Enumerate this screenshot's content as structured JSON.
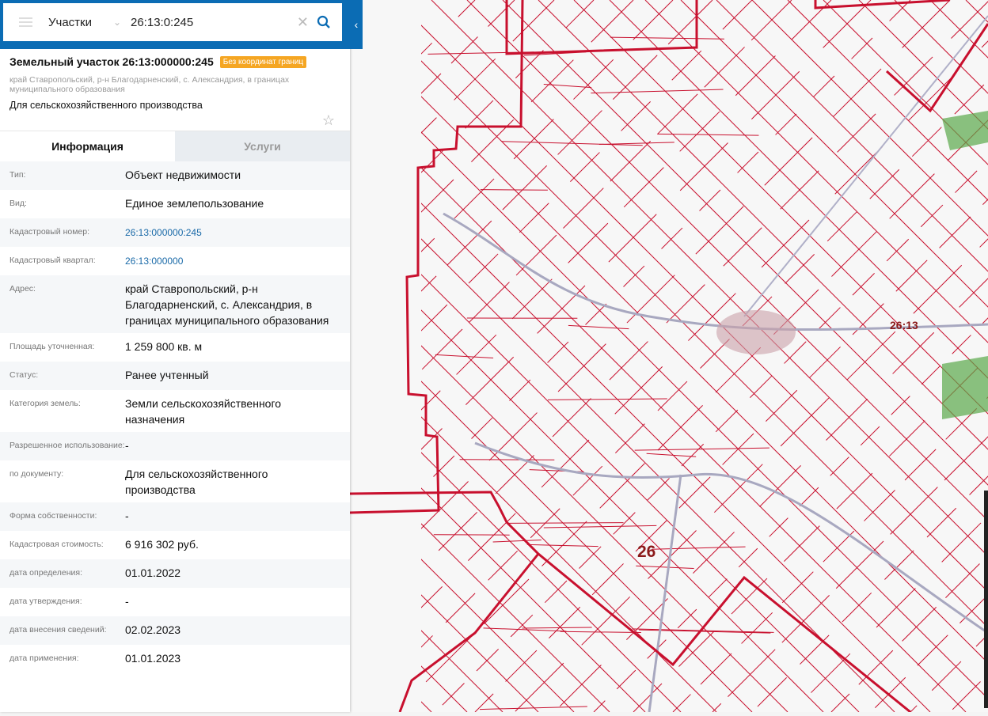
{
  "search": {
    "layer": "Участки",
    "query": "26:13:0:245"
  },
  "object": {
    "title": "Земельный участок 26:13:000000:245",
    "badge": "Без координат границ",
    "address": "край Ставропольский, р-н Благодарненский, с. Александрия, в границах муниципального образования",
    "purpose": "Для сельскохозяйственного производства"
  },
  "tabs": [
    "Информация",
    "Услуги"
  ],
  "rows": [
    {
      "label": "Тип:",
      "value": "Объект недвижимости"
    },
    {
      "label": "Вид:",
      "value": "Единое землепользование"
    },
    {
      "label": "Кадастровый номер:",
      "value": "26:13:000000:245",
      "link": true
    },
    {
      "label": "Кадастровый квартал:",
      "value": "26:13:000000",
      "link": true
    },
    {
      "label": "Адрес:",
      "value": "край Ставропольский, р-н Благодарненский, с. Александрия, в границах муниципального образования"
    },
    {
      "label": "Площадь уточненная:",
      "value": "1 259 800 кв. м"
    },
    {
      "label": "Статус:",
      "value": "Ранее учтенный"
    },
    {
      "label": "Категория земель:",
      "value": "Земли сельскохозяйственного назначения"
    },
    {
      "label": "Разрешенное использование:",
      "value": "-"
    },
    {
      "label": "по документу:",
      "value": "Для сельскохозяйственного производства"
    },
    {
      "label": "Форма собственности:",
      "value": "-"
    },
    {
      "label": "Кадастровая стоимость:",
      "value": "6 916 302 руб."
    },
    {
      "label": "дата определения:",
      "value": "01.01.2022"
    },
    {
      "label": "дата утверждения:",
      "value": "-"
    },
    {
      "label": "дата внесения сведений:",
      "value": "02.02.2023"
    },
    {
      "label": "дата применения:",
      "value": "01.01.2023"
    }
  ],
  "map": {
    "labels": [
      "26:13",
      "26"
    ],
    "boundary_color": "#c8102e",
    "accent": "#0b6cb4"
  }
}
